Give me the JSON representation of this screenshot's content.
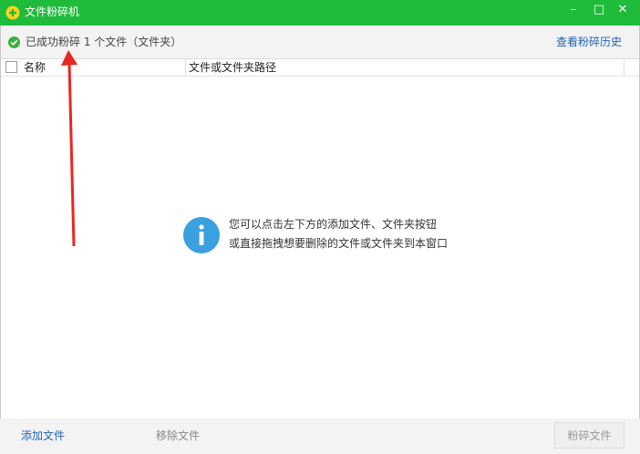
{
  "window": {
    "title": "文件粉碎机",
    "minimize_label": "–",
    "maximize_label": "□",
    "close_label": "✕"
  },
  "status": {
    "text": "已成功粉碎 1 个文件（文件夹）",
    "history_link": "查看粉碎历史",
    "icon": "check-circle-icon"
  },
  "table": {
    "columns": [
      "名称",
      "文件或文件夹路径"
    ],
    "rows": []
  },
  "empty_hint": {
    "icon": "info-icon",
    "line1": "您可以点击左下方的添加文件、文件夹按钮",
    "line2": "或直接拖拽想要删除的文件或文件夹到本窗口"
  },
  "footer": {
    "add_label": "添加文件",
    "remove_label": "移除文件",
    "shred_label": "粉碎文件"
  },
  "colors": {
    "titlebar": "#1fbb3b",
    "link": "#1d63b3",
    "info": "#3aa0e0",
    "annotation_arrow": "#e8281e"
  }
}
